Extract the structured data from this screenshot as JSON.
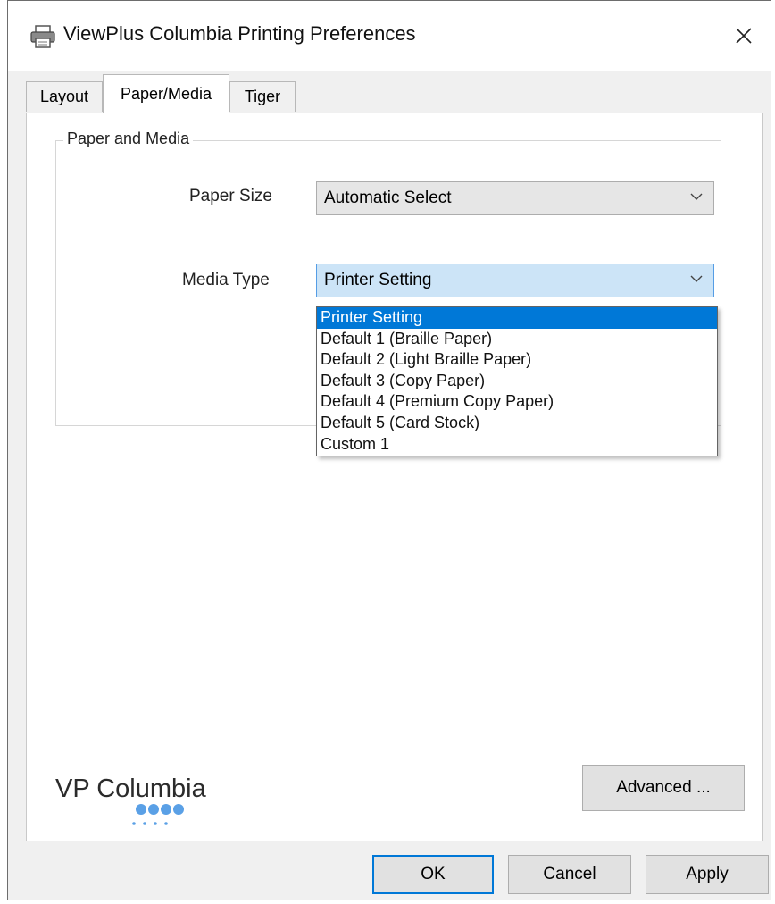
{
  "window": {
    "title": "ViewPlus Columbia Printing Preferences"
  },
  "tabs": [
    {
      "label": "Layout"
    },
    {
      "label": "Paper/Media",
      "active": true
    },
    {
      "label": "Tiger"
    }
  ],
  "group": {
    "label": "Paper and Media",
    "paper_size": {
      "label": "Paper Size",
      "value": "Automatic Select"
    },
    "media_type": {
      "label": "Media Type",
      "value": "Printer Setting",
      "options": [
        "Printer Setting",
        "Default 1 (Braille Paper)",
        "Default 2 (Light Braille Paper)",
        "Default 3 (Copy Paper)",
        "Default 4 (Premium Copy Paper)",
        "Default 5 (Card Stock)",
        "Custom 1"
      ],
      "selected_index": 0
    }
  },
  "brand": {
    "logo_text": "VP Columbia"
  },
  "buttons": {
    "advanced": "Advanced ...",
    "ok": "OK",
    "cancel": "Cancel",
    "apply": "Apply"
  },
  "colors": {
    "accent": "#0078d7",
    "dropdown_open_bg": "#cce4f7",
    "logo_dots": "#5aa0e6"
  },
  "icons": {
    "title": "printer-icon",
    "close": "close-icon",
    "dropdown": "chevron-down-icon"
  }
}
